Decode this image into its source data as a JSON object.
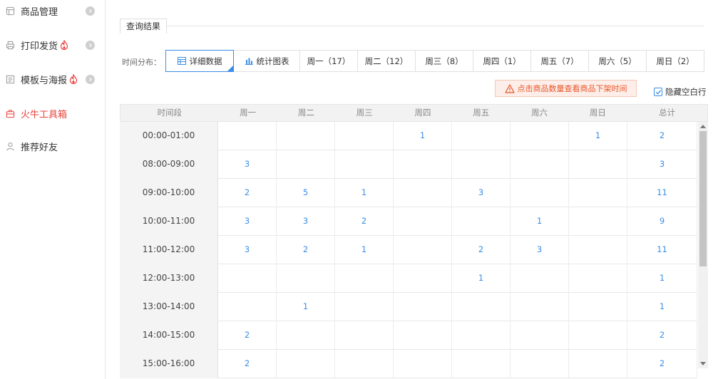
{
  "sidebar": {
    "items": [
      {
        "label": "商品管理",
        "icon": "shop-icon",
        "flame": false,
        "chevron": true,
        "active": false
      },
      {
        "label": "打印发货",
        "icon": "printer-icon",
        "flame": true,
        "chevron": true,
        "active": false
      },
      {
        "label": "模板与海报",
        "icon": "template-icon",
        "flame": true,
        "chevron": true,
        "active": false
      },
      {
        "label": "火牛工具箱",
        "icon": "toolbox-icon",
        "flame": false,
        "chevron": false,
        "active": true
      },
      {
        "label": "推荐好友",
        "icon": "user-icon",
        "flame": false,
        "chevron": false,
        "active": false
      }
    ]
  },
  "section": {
    "title": "查询结果"
  },
  "filter": {
    "label": "时间分布：",
    "tabs": [
      {
        "label": "详细数据",
        "icon": "table-icon",
        "active": true
      },
      {
        "label": "统计图表",
        "icon": "bar-chart-icon",
        "active": false
      },
      {
        "label": "周一（17）"
      },
      {
        "label": "周二（12）"
      },
      {
        "label": "周三（8）"
      },
      {
        "label": "周四（1）"
      },
      {
        "label": "周五（7）"
      },
      {
        "label": "周六（5）"
      },
      {
        "label": "周日（2）"
      }
    ]
  },
  "notice": {
    "text": "点击商品数量查看商品下架时间"
  },
  "hide_empty": {
    "label": "隐藏空白行",
    "checked": true
  },
  "colors": {
    "accent": "#3a8ee6",
    "active_red": "#e8423c",
    "notice_bg": "#fdeee9",
    "notice_text": "#e8562a"
  },
  "table": {
    "headers": [
      "时间段",
      "周一",
      "周二",
      "周三",
      "周四",
      "周五",
      "周六",
      "周日",
      "总计"
    ],
    "rows": [
      [
        "00:00-01:00",
        "",
        "",
        "",
        "1",
        "",
        "",
        "1",
        "2"
      ],
      [
        "08:00-09:00",
        "3",
        "",
        "",
        "",
        "",
        "",
        "",
        "3"
      ],
      [
        "09:00-10:00",
        "2",
        "5",
        "1",
        "",
        "3",
        "",
        "",
        "11"
      ],
      [
        "10:00-11:00",
        "3",
        "3",
        "2",
        "",
        "",
        "1",
        "",
        "9"
      ],
      [
        "11:00-12:00",
        "3",
        "2",
        "1",
        "",
        "2",
        "3",
        "",
        "11"
      ],
      [
        "12:00-13:00",
        "",
        "",
        "",
        "",
        "1",
        "",
        "",
        "1"
      ],
      [
        "13:00-14:00",
        "",
        "1",
        "",
        "",
        "",
        "",
        "",
        "1"
      ],
      [
        "14:00-15:00",
        "2",
        "",
        "",
        "",
        "",
        "",
        "",
        "2"
      ],
      [
        "15:00-16:00",
        "2",
        "",
        "",
        "",
        "",
        "",
        "",
        "2"
      ]
    ]
  }
}
